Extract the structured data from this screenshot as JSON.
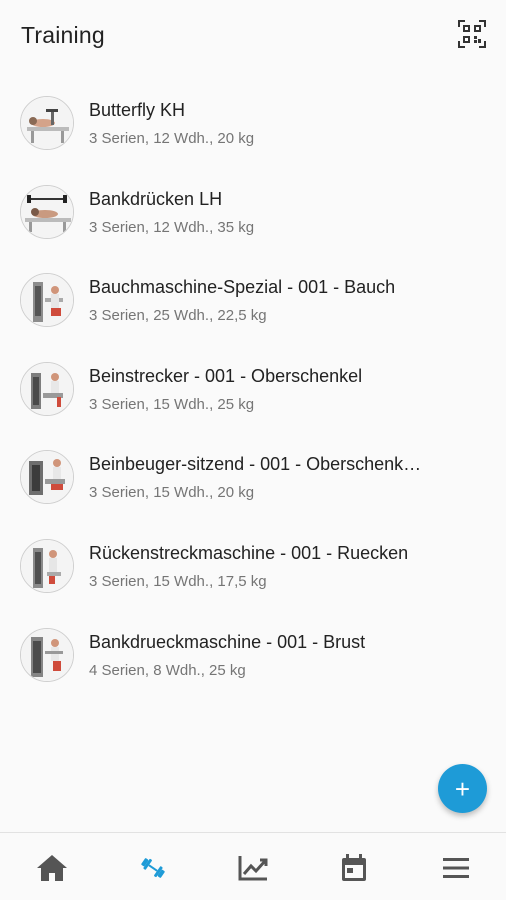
{
  "header": {
    "title": "Training",
    "scan_icon": "qr-code-scan-icon"
  },
  "exercises": [
    {
      "name": "Butterfly KH",
      "details": "3 Serien, 12 Wdh., 20 kg"
    },
    {
      "name": "Bankdrücken LH",
      "details": "3 Serien, 12 Wdh., 35 kg"
    },
    {
      "name": "Bauchmaschine-Spezial - 001 - Bauch",
      "details": "3 Serien, 25 Wdh., 22,5 kg"
    },
    {
      "name": "Beinstrecker - 001 - Oberschenkel",
      "details": "3 Serien, 15 Wdh., 25 kg"
    },
    {
      "name": "Beinbeuger-sitzend - 001 - Oberschenk…",
      "details": "3 Serien, 15 Wdh., 20 kg"
    },
    {
      "name": "Rückenstreckmaschine - 001 - Ruecken",
      "details": "3 Serien, 15 Wdh., 17,5 kg"
    },
    {
      "name": "Bankdrueckmaschine - 001 - Brust",
      "details": "4 Serien, 8 Wdh., 25 kg"
    }
  ],
  "fab": {
    "label": "+"
  },
  "bottom_nav": {
    "items": [
      "home-icon",
      "dumbbell-icon",
      "chart-icon",
      "calendar-icon",
      "menu-icon"
    ],
    "active": "dumbbell-icon",
    "active_color": "#1e9bd7",
    "inactive_color": "#555555"
  },
  "colors": {
    "accent": "#1e9bd7"
  }
}
